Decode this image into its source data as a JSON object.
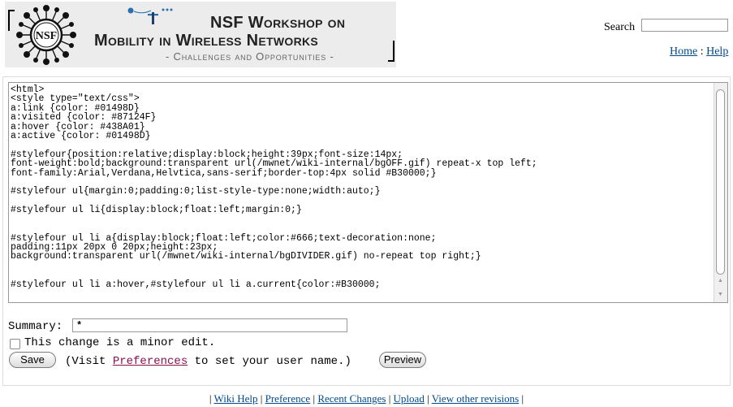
{
  "header": {
    "workshop_line1": "NSF Workshop on",
    "workshop_line2": "Mobility in Wireless Networks",
    "workshop_line3": "- Challenges and Opportunities -",
    "seal_text": "NSF"
  },
  "search": {
    "label": "Search",
    "value": ""
  },
  "top_links": {
    "home": "Home",
    "separator": " : ",
    "help": "Help"
  },
  "editor": {
    "content": "<html>\n<style type=\"text/css\">\na:link {color: #01498D}\na:visited {color: #87124F}\na:hover {color: #438A01}\na:active {color: #01498D}\n\n#stylefour{position:relative;display:block;height:39px;font-size:14px;\nfont-weight:bold;background:transparent url(/mwnet/wiki-internal/bgOFF.gif) repeat-x top left;\nfont-family:Arial,Verdana,Helvtica,sans-serif;border-top:4px solid #B30000;}\n\n#stylefour ul{margin:0;padding:0;list-style-type:none;width:auto;}\n\n#stylefour ul li{display:block;float:left;margin:0;}\n\n\n#stylefour ul li a{display:block;float:left;color:#666;text-decoration:none;\npadding:11px 20px 0 20px;height:23px;\nbackground:transparent url(/mwnet/wiki-internal/bgDIVIDER.gif) no-repeat top right;}\n\n\n#stylefour ul li a:hover,#stylefour ul li a.current{color:#B30000;"
  },
  "form": {
    "summary_label": "Summary:",
    "summary_value": "*",
    "minor_edit_checked": false,
    "minor_edit_label": "This change is a minor edit.",
    "save_label": "Save",
    "visit_prefix": "(Visit ",
    "preferences_link": "Preferences",
    "visit_suffix": " to set your user name.)",
    "preview_label": "Preview"
  },
  "footer": {
    "open": "| ",
    "links": [
      "Wiki Help",
      "Preference",
      "Recent Changes",
      "Upload",
      "View other revisions"
    ],
    "separator": " | ",
    "close": " |"
  },
  "colors": {
    "link": "#01498D",
    "visited": "#87124F",
    "banner_bg": "#ececec"
  },
  "icons": [
    "nsf-seal-icon",
    "satellite-mobility-icon",
    "scroll-up-icon",
    "scroll-down-icon",
    "checkbox-icon"
  ]
}
